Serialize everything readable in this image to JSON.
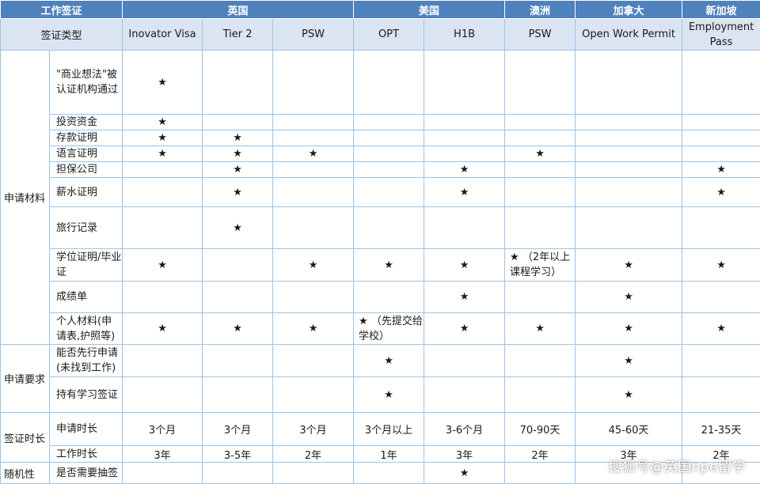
{
  "header": {
    "corner": "工作签证",
    "countries": [
      "英国",
      "美国",
      "澳洲",
      "加拿大",
      "新加坡"
    ],
    "type_label": "签证类型",
    "visas": [
      "Inovator Visa",
      "Tier 2",
      "PSW",
      "OPT",
      "H1B",
      "PSW",
      "Open Work Permit",
      "Employment Pass"
    ]
  },
  "sections": {
    "materials": "申请材料",
    "requirements": "申请要求",
    "duration": "签证时长",
    "random": "随机性"
  },
  "rows": [
    {
      "item": "\"商业想法\"被认证机构通过",
      "cells": [
        "★",
        "",
        "",
        "",
        "",
        "",
        "",
        ""
      ]
    },
    {
      "item": "投资资金",
      "cells": [
        "★",
        "",
        "",
        "",
        "",
        "",
        "",
        ""
      ]
    },
    {
      "item": "存款证明",
      "cells": [
        "★",
        "★",
        "",
        "",
        "",
        "",
        "",
        ""
      ]
    },
    {
      "item": "语言证明",
      "cells": [
        "★",
        "★",
        "★",
        "",
        "",
        "★",
        "",
        ""
      ]
    },
    {
      "item": "担保公司",
      "cells": [
        "",
        "★",
        "",
        "",
        "★",
        "",
        "",
        "★"
      ]
    },
    {
      "item": "薪水证明",
      "cells": [
        "",
        "★",
        "",
        "",
        "★",
        "",
        "",
        "★"
      ]
    },
    {
      "item": "旅行记录",
      "cells": [
        "",
        "★",
        "",
        "",
        "",
        "",
        "",
        ""
      ]
    },
    {
      "item": "学位证明/毕业证",
      "cells": [
        "★",
        "",
        "★",
        "★",
        "★",
        "★ （2年以上课程学习）",
        "★",
        "★"
      ]
    },
    {
      "item": "成绩单",
      "cells": [
        "",
        "",
        "",
        "",
        "★",
        "",
        "★",
        ""
      ]
    },
    {
      "item": "个人材料(申请表,护照等)",
      "cells": [
        "★",
        "★",
        "★",
        "★ （先提交给学校）",
        "★",
        "★",
        "★",
        "★"
      ]
    },
    {
      "item": "能否先行申请(未找到工作)",
      "cells": [
        "",
        "",
        "",
        "★",
        "",
        "",
        "★",
        ""
      ]
    },
    {
      "item": "持有学习签证",
      "cells": [
        "",
        "",
        "",
        "★",
        "",
        "",
        "★",
        ""
      ]
    },
    {
      "item": "申请时长",
      "cells": [
        "3个月",
        "3个月",
        "3个月",
        "3个月以上",
        "3-6个月",
        "70-90天",
        "45-60天",
        "21-35天"
      ]
    },
    {
      "item": "工作时长",
      "cells": [
        "3年",
        "3-5年",
        "2年",
        "1年",
        "3年",
        "2年",
        "3年",
        "2年"
      ]
    },
    {
      "item": "是否需要抽签",
      "cells": [
        "",
        "",
        "",
        "",
        "★",
        "",
        "",
        ""
      ]
    }
  ],
  "watermark": "搜狐号@英国npe留学",
  "colors": {
    "header_dark": "#4f81bd",
    "header_light": "#dbe5f1",
    "grid": "#9dc3e6"
  }
}
